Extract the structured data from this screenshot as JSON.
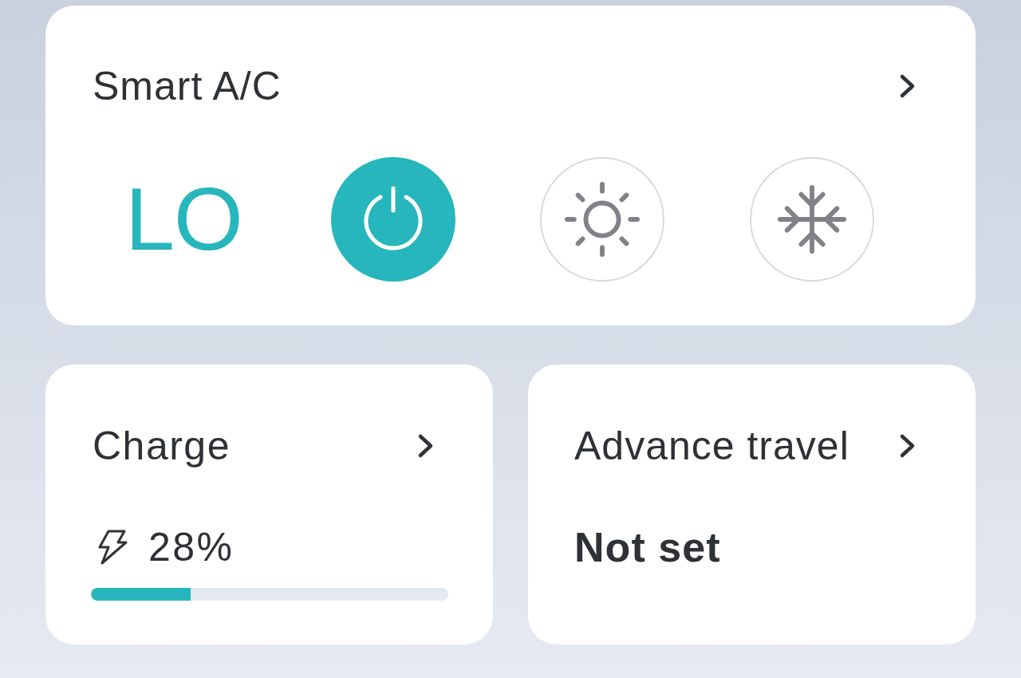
{
  "smart_ac": {
    "title": "Smart A/C",
    "temperature": "LO",
    "modes": [
      {
        "kind": "power",
        "selected": true
      },
      {
        "kind": "heat",
        "selected": false
      },
      {
        "kind": "cool",
        "selected": false
      }
    ]
  },
  "charge": {
    "title": "Charge",
    "reading": "28%",
    "level": 0.28
  },
  "advance_travel": {
    "title": "Advance travel",
    "value": "Not set"
  }
}
